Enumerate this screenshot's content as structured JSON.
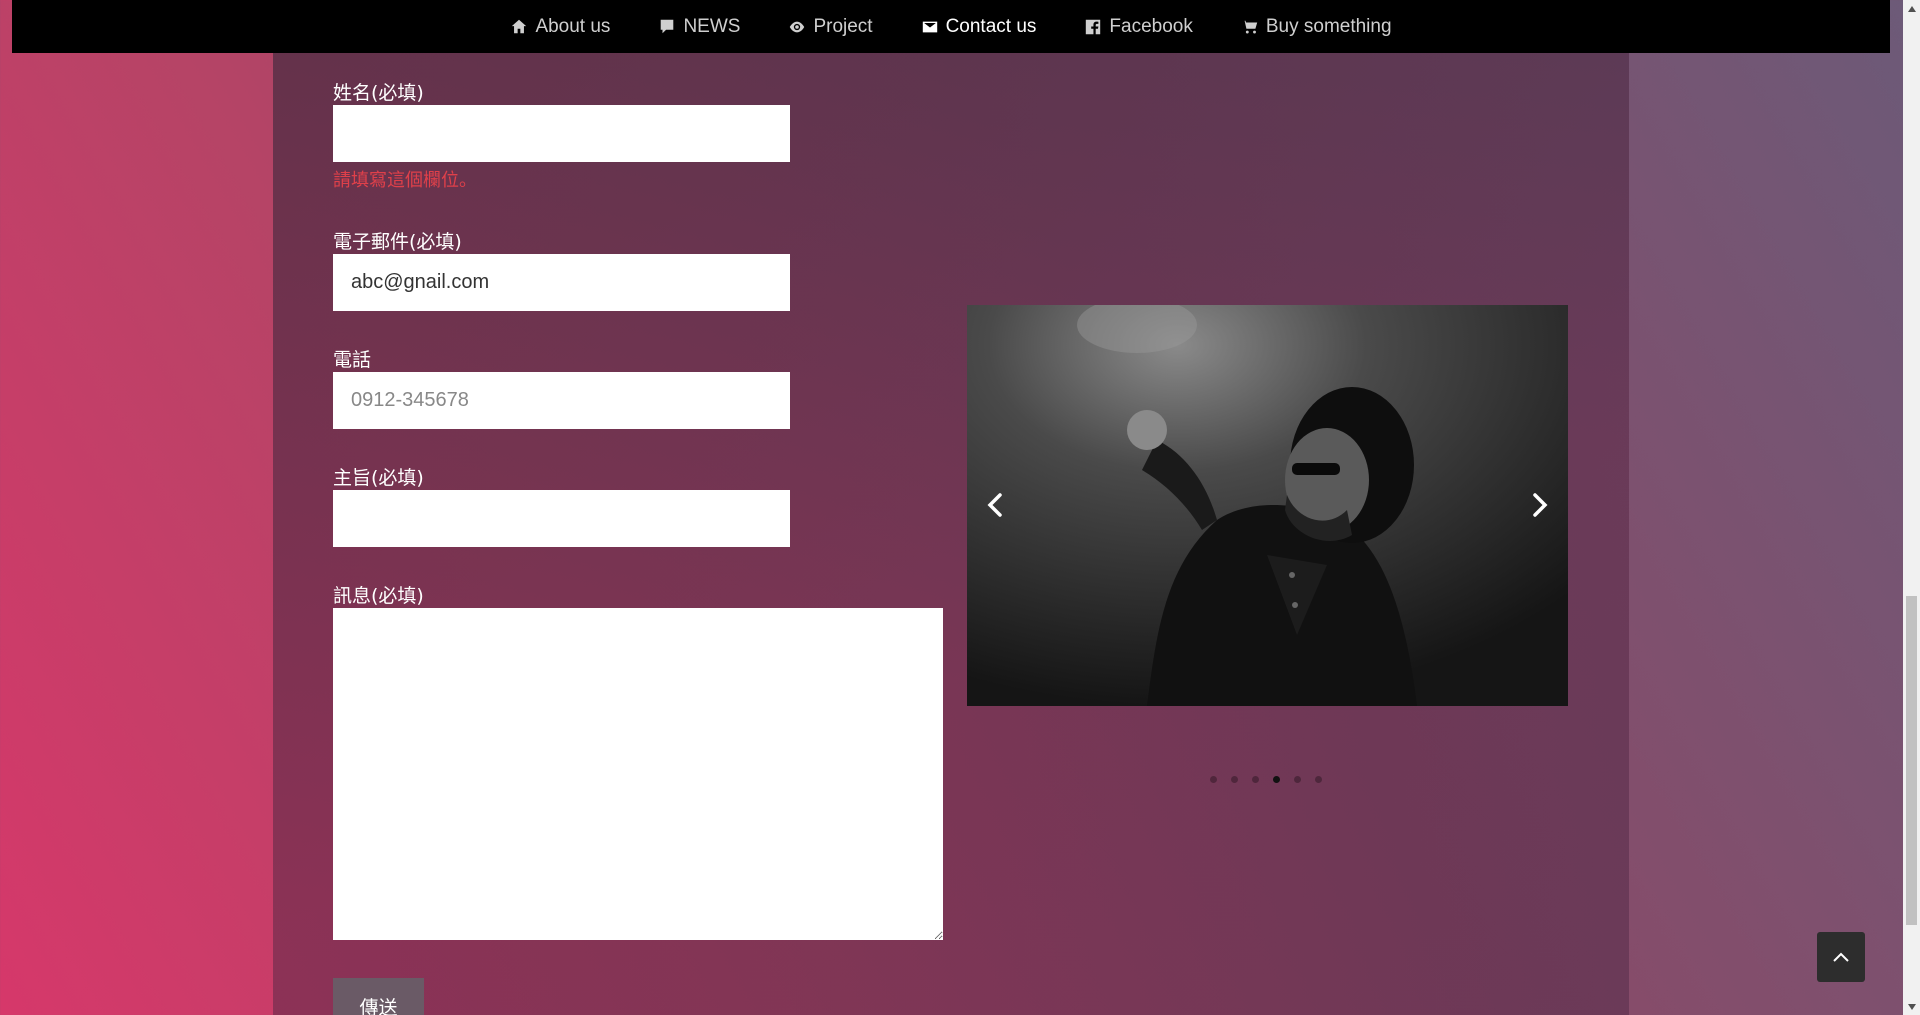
{
  "nav": {
    "items": [
      {
        "label": "About us",
        "icon": "home-icon"
      },
      {
        "label": "NEWS",
        "icon": "speech-bubble-icon"
      },
      {
        "label": "Project",
        "icon": "eye-icon"
      },
      {
        "label": "Contact us",
        "icon": "envelope-icon"
      },
      {
        "label": "Facebook",
        "icon": "facebook-icon"
      },
      {
        "label": "Buy something",
        "icon": "cart-icon"
      }
    ],
    "active": "Contact us"
  },
  "form": {
    "name_label": "姓名(必填)",
    "name_value": "",
    "name_error": "請填寫這個欄位。",
    "email_label": "電子郵件(必填)",
    "email_value": "abc@gnail.com",
    "phone_label": "電話",
    "phone_placeholder": "0912-345678",
    "subject_label": "主旨(必填)",
    "subject_value": "",
    "message_label": "訊息(必填)",
    "message_value": "",
    "send_label": "傳送"
  },
  "slider": {
    "image_alt": "black and white portrait",
    "prev_icon": "chevron-left-icon",
    "next_icon": "chevron-right-icon",
    "dot_count": 6,
    "active_dot": 4
  },
  "colors": {
    "error": "#e0404a",
    "topbar": "#000000"
  }
}
